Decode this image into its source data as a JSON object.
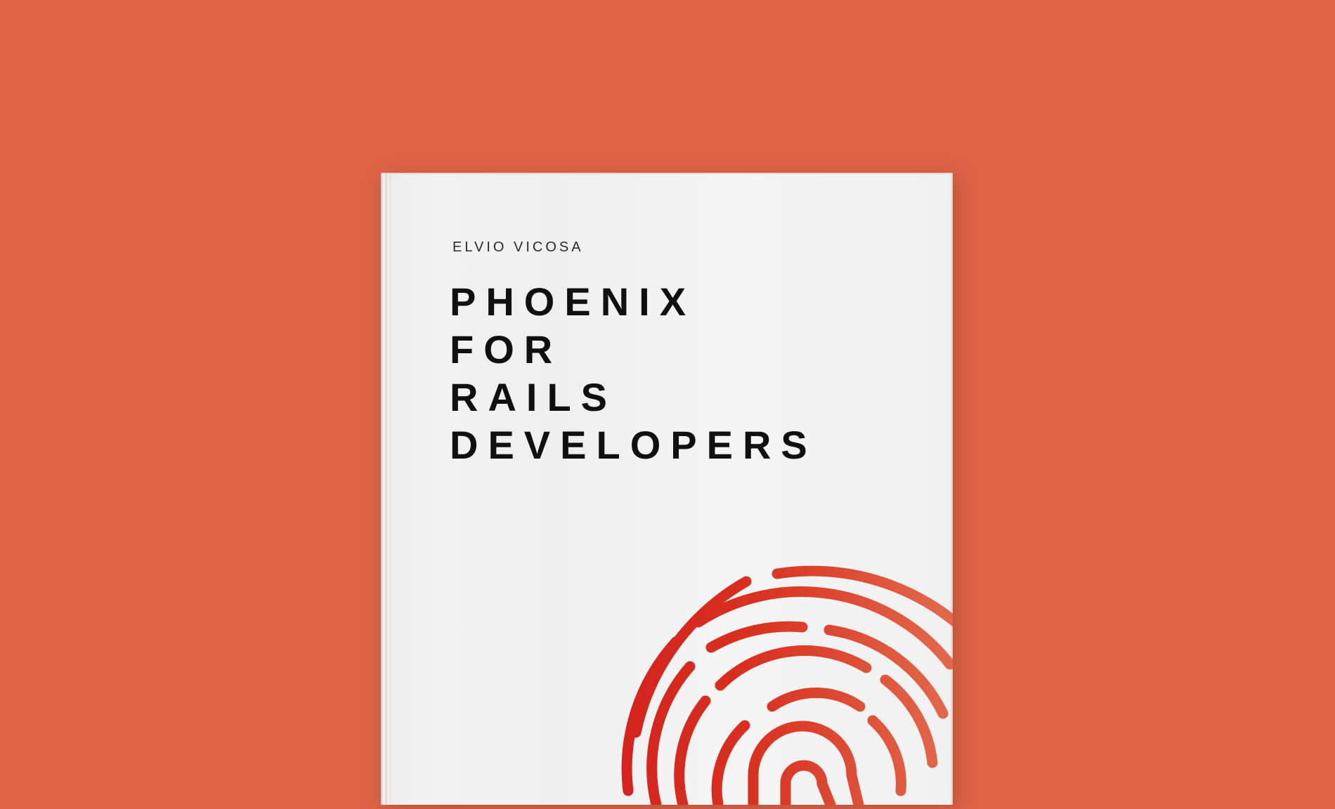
{
  "cover": {
    "author": "ELVIO VICOSA",
    "title_lines": [
      "PHOENIX",
      "FOR",
      "RAILS",
      "DEVELOPERS"
    ]
  },
  "colors": {
    "background": "#DE6448",
    "cover": "#F1F1F1",
    "title_text": "#101010",
    "fingerprint_primary": "#D4201E",
    "fingerprint_secondary": "#E2674A"
  },
  "cover_art": {
    "icon": "fingerprint-icon"
  }
}
